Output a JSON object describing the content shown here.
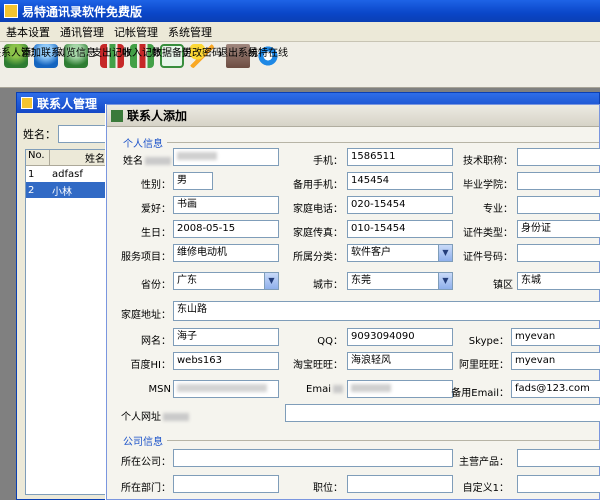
{
  "app": {
    "title": "易特通讯录软件免费版"
  },
  "menu": [
    "基本设置",
    "通讯管理",
    "记帐管理",
    "系统管理"
  ],
  "toolbar": [
    {
      "label": "联系人管理",
      "icon": "contacts-icon",
      "color": "#2e7d32"
    },
    {
      "label": "添加联系人",
      "icon": "add-contact-icon",
      "color": "#1565c0"
    },
    {
      "label": "浏览信息",
      "icon": "browse-icon",
      "color": "#2e7d32"
    },
    {
      "label": "支出记帐",
      "icon": "expense-chart-icon",
      "color": "#c62828"
    },
    {
      "label": "收入记帐",
      "icon": "income-chart-icon",
      "color": "#2e7d32"
    },
    {
      "label": "数据备份",
      "icon": "backup-icon",
      "color": "#388e3c"
    },
    {
      "label": "更改密码",
      "icon": "key-icon",
      "color": "#f9a825"
    },
    {
      "label": "退出系统",
      "icon": "exit-icon",
      "color": "#8d6e63"
    },
    {
      "label": "易特在线",
      "icon": "ie-icon",
      "color": "#1e88e5"
    }
  ],
  "manager": {
    "title": "联系人管理",
    "search_label": "姓名：",
    "columns": [
      "No.",
      "姓名"
    ],
    "rows": [
      {
        "no": "1",
        "name": "adfasf"
      },
      {
        "no": "2",
        "name": "小林"
      }
    ]
  },
  "dialog": {
    "title": "联系人添加",
    "personal_section": "个人信息",
    "company_section": "公司信息",
    "fields": {
      "name": {
        "label": "姓名",
        "value": ""
      },
      "mobile": {
        "label": "手机：",
        "value": "1586511"
      },
      "tech_title": {
        "label": "技术职称：",
        "value": ""
      },
      "gender": {
        "label": "性别：",
        "value": "男"
      },
      "backup_mobile": {
        "label": "备用手机：",
        "value": "145454"
      },
      "school": {
        "label": "毕业学院：",
        "value": ""
      },
      "hobby": {
        "label": "爱好：",
        "value": "书画"
      },
      "home_phone": {
        "label": "家庭电话：",
        "value": "020-15454"
      },
      "major": {
        "label": "专业：",
        "value": ""
      },
      "birthday": {
        "label": "生日：",
        "value": "2008-05-15"
      },
      "home_fax": {
        "label": "家庭传真：",
        "value": "010-15454"
      },
      "id_type": {
        "label": "证件类型：",
        "value": "身份证"
      },
      "service": {
        "label": "服务项目：",
        "value": "维修电动机"
      },
      "category": {
        "label": "所属分类：",
        "value": "软件客户"
      },
      "id_number": {
        "label": "证件号码：",
        "value": ""
      },
      "province": {
        "label": "省份：",
        "value": "广东"
      },
      "city": {
        "label": "城市：",
        "value": "东莞"
      },
      "town": {
        "label": "镇区",
        "value": "东城"
      },
      "address": {
        "label": "家庭地址：",
        "value": "东山路"
      },
      "nickname": {
        "label": "网名：",
        "value": "海子"
      },
      "qq": {
        "label": "QQ：",
        "value": "9093094090"
      },
      "skype": {
        "label": "Skype：",
        "value": "myevan"
      },
      "baidu_hi": {
        "label": "百度HI：",
        "value": "webs163"
      },
      "taobao": {
        "label": "淘宝旺旺：",
        "value": "海浪轻风"
      },
      "alibaba": {
        "label": "阿里旺旺：",
        "value": "myevan"
      },
      "msn": {
        "label": "MSN",
        "value": ""
      },
      "email": {
        "label": "Emai",
        "value": ""
      },
      "backup_email": {
        "label": "备用Email：",
        "value": "fads@123.com"
      },
      "website": {
        "label": "个人网址",
        "value": ""
      },
      "company": {
        "label": "所在公司：",
        "value": ""
      },
      "main_product": {
        "label": "主营产品：",
        "value": ""
      },
      "department": {
        "label": "所在部门：",
        "value": ""
      },
      "position": {
        "label": "职位：",
        "value": ""
      },
      "custom1": {
        "label": "自定义1：",
        "value": ""
      }
    }
  }
}
